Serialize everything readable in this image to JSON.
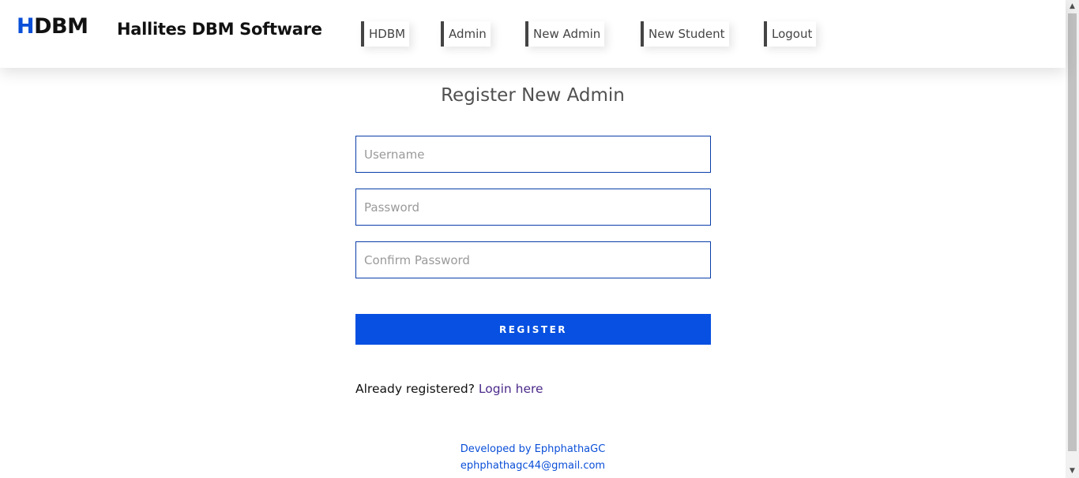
{
  "header": {
    "logo_first": "H",
    "logo_rest": "DBM",
    "brand": "Hallites DBM Software",
    "nav": [
      {
        "label": "HDBM"
      },
      {
        "label": "Admin"
      },
      {
        "label": "New Admin"
      },
      {
        "label": "New Student"
      },
      {
        "label": "Logout"
      }
    ]
  },
  "main": {
    "title": "Register New Admin",
    "username_placeholder": "Username",
    "password_placeholder": "Password",
    "confirm_placeholder": "Confirm Password",
    "register_label": "REGISTER",
    "already_text": "Already registered?",
    "login_link": "Login here"
  },
  "footer": {
    "developed_by": "Developed by EphphathaGC",
    "email": "ephphathagc44@gmail.com"
  },
  "colors": {
    "accent": "#0750e1",
    "link": "#4b2a8a",
    "field_border": "#0a3ea8"
  }
}
